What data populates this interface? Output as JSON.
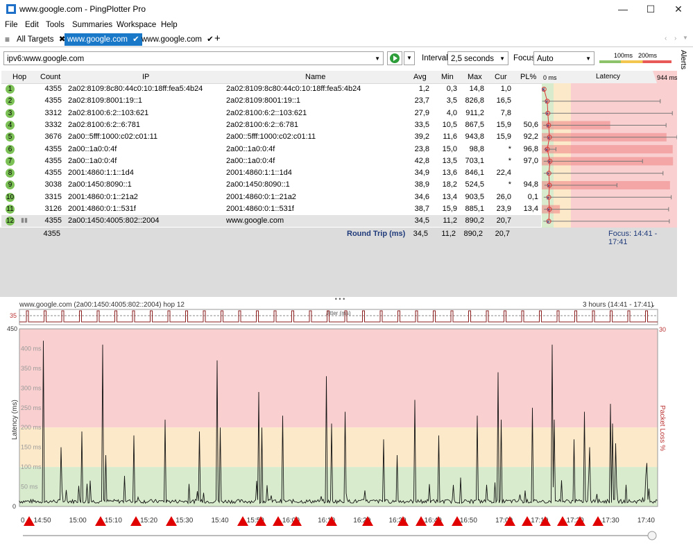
{
  "window": {
    "title": "www.google.com - PingPlotter Pro",
    "controls": [
      "—",
      "☐",
      "✕"
    ]
  },
  "menu": [
    "File",
    "Edit",
    "Tools",
    "Summaries",
    "Workspace",
    "Help"
  ],
  "tabs": [
    {
      "label": "All Targets",
      "mark": "✖"
    },
    {
      "label": "www.google.com",
      "mark": "✔",
      "active": true
    },
    {
      "label": "www.google.com",
      "mark": "✔"
    }
  ],
  "tab_add": "+",
  "toolbar": {
    "target": "ipv6:www.google.com",
    "interval_label": "Interval",
    "interval_value": "2,5 seconds",
    "focus_label": "Focus",
    "focus_value": "Auto",
    "threshold_100": "100ms",
    "threshold_200": "200ms"
  },
  "alerts_label": "Alerts",
  "table": {
    "headers": {
      "hop": "Hop",
      "count": "Count",
      "ip": "IP",
      "name": "Name",
      "avg": "Avg",
      "min": "Min",
      "max": "Max",
      "cur": "Cur",
      "pl": "PL%",
      "lat0": "0 ms",
      "latency": "Latency",
      "latmax": "944 ms"
    },
    "rows": [
      {
        "hop": "1",
        "count": "4355",
        "ip": "2a02:8109:8c80:44c0:10:18ff:fea5:4b24",
        "name": "2a02:8109:8c80:44c0:10:18ff:fea5:4b24",
        "avg": "1,2",
        "min": "0,3",
        "max": "14,8",
        "cur": "1,0",
        "pl": ""
      },
      {
        "hop": "2",
        "count": "4355",
        "ip": "2a02:8109:8001:19::1",
        "name": "2a02:8109:8001:19::1",
        "avg": "23,7",
        "min": "3,5",
        "max": "826,8",
        "cur": "16,5",
        "pl": ""
      },
      {
        "hop": "3",
        "count": "3312",
        "ip": "2a02:8100:6:2::103:621",
        "name": "2a02:8100:6:2::103:621",
        "avg": "27,9",
        "min": "4,0",
        "max": "911,2",
        "cur": "7,8",
        "pl": ""
      },
      {
        "hop": "4",
        "count": "3332",
        "ip": "2a02:8100:6:2::6:781",
        "name": "2a02:8100:6:2::6:781",
        "avg": "33,5",
        "min": "10,5",
        "max": "867,5",
        "cur": "15,9",
        "pl": "50,6"
      },
      {
        "hop": "5",
        "count": "3676",
        "ip": "2a00::5fff:1000:c02:c01:11",
        "name": "2a00::5fff:1000:c02:c01:11",
        "avg": "39,2",
        "min": "11,6",
        "max": "943,8",
        "cur": "15,9",
        "pl": "92,2"
      },
      {
        "hop": "6",
        "count": "4355",
        "ip": "2a00::1a0:0:4f",
        "name": "2a00::1a0:0:4f",
        "avg": "23,8",
        "min": "15,0",
        "max": "98,8",
        "cur": "*",
        "pl": "96,8"
      },
      {
        "hop": "7",
        "count": "4355",
        "ip": "2a00::1a0:0:4f",
        "name": "2a00::1a0:0:4f",
        "avg": "42,8",
        "min": "13,5",
        "max": "703,1",
        "cur": "*",
        "pl": "97,0"
      },
      {
        "hop": "8",
        "count": "4355",
        "ip": "2001:4860:1:1::1d4",
        "name": "2001:4860:1:1::1d4",
        "avg": "34,9",
        "min": "13,6",
        "max": "846,1",
        "cur": "22,4",
        "pl": ""
      },
      {
        "hop": "9",
        "count": "3038",
        "ip": "2a00:1450:8090::1",
        "name": "2a00:1450:8090::1",
        "avg": "38,9",
        "min": "18,2",
        "max": "524,5",
        "cur": "*",
        "pl": "94,8"
      },
      {
        "hop": "10",
        "count": "3315",
        "ip": "2001:4860:0:1::21a2",
        "name": "2001:4860:0:1::21a2",
        "avg": "34,6",
        "min": "13,4",
        "max": "903,5",
        "cur": "26,0",
        "pl": "0,1"
      },
      {
        "hop": "11",
        "count": "3126",
        "ip": "2001:4860:0:1::531f",
        "name": "2001:4860:0:1::531f",
        "avg": "38,7",
        "min": "15,9",
        "max": "885,1",
        "cur": "23,9",
        "pl": "13,4"
      },
      {
        "hop": "12",
        "count": "4355",
        "ip": "2a00:1450:4005:802::2004",
        "name": "www.google.com",
        "avg": "34,5",
        "min": "11,2",
        "max": "890,2",
        "cur": "20,7",
        "pl": ""
      }
    ],
    "summary": {
      "count": "4355",
      "label": "Round Trip (ms)",
      "avg": "34,5",
      "min": "11,2",
      "max": "890,2",
      "cur": "20,7",
      "focus": "Focus: 14:41 - 17:41"
    }
  },
  "splitter": "• • •",
  "graph": {
    "title": "www.google.com (2a00:1450:4005:802::2004) hop 12",
    "range": "3 hours (14:41 - 17:41)",
    "jitter_label": "Jitter (ms)",
    "jitter_max": "35",
    "y_top": "450",
    "y_bottom": "0",
    "y_ticks": [
      "400 ms",
      "350 ms",
      "300 ms",
      "250 ms",
      "200 ms",
      "150 ms",
      "100 ms",
      "50 ms"
    ],
    "y_label": "Latency (ms)",
    "pl_top": "30",
    "pl_label": "Packet Loss %",
    "x_ticks": [
      "0",
      "14:50",
      "15:00",
      "15:10",
      "15:20",
      "15:30",
      "15:40",
      "15:50",
      "16:00",
      "16:10",
      "16:20",
      "16:30",
      "16:40",
      "16:50",
      "17:00",
      "17:10",
      "17:20",
      "17:30",
      "17:40"
    ],
    "colors": {
      "red": "#f9cfcf",
      "yellow": "#fce9c9",
      "green": "#d8eccd",
      "loss": "#e00000"
    }
  }
}
